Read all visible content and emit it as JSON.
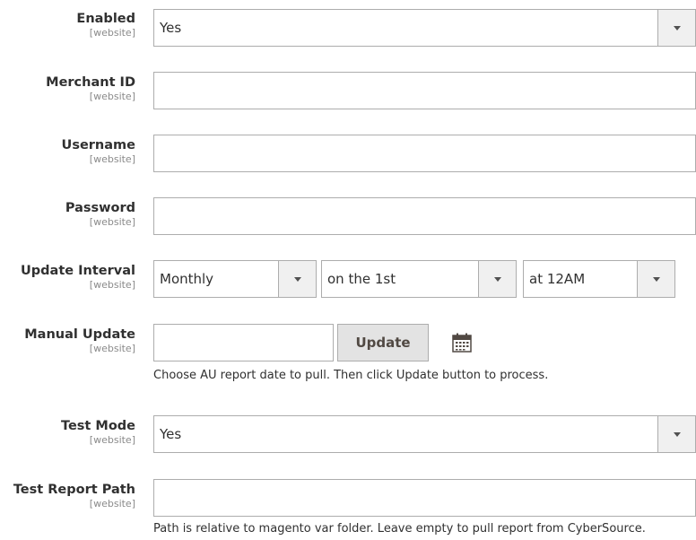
{
  "scope_label": "[website]",
  "fields": {
    "enabled": {
      "label": "Enabled",
      "value": "Yes"
    },
    "merchant_id": {
      "label": "Merchant ID",
      "value": ""
    },
    "username": {
      "label": "Username",
      "value": ""
    },
    "password": {
      "label": "Password",
      "value": ""
    },
    "update_interval": {
      "label": "Update Interval",
      "frequency": "Monthly",
      "day": "on the 1st",
      "time": "at 12AM"
    },
    "manual_update": {
      "label": "Manual Update",
      "date_value": "",
      "button_label": "Update",
      "note": "Choose AU report date to pull. Then click Update button to process."
    },
    "test_mode": {
      "label": "Test Mode",
      "value": "Yes"
    },
    "test_report_path": {
      "label": "Test Report Path",
      "value": "",
      "note": "Path is relative to magento var folder. Leave empty to pull report from CyberSource."
    }
  },
  "icons": {
    "calendar": "calendar-icon",
    "dropdown": "chevron-down-icon"
  }
}
